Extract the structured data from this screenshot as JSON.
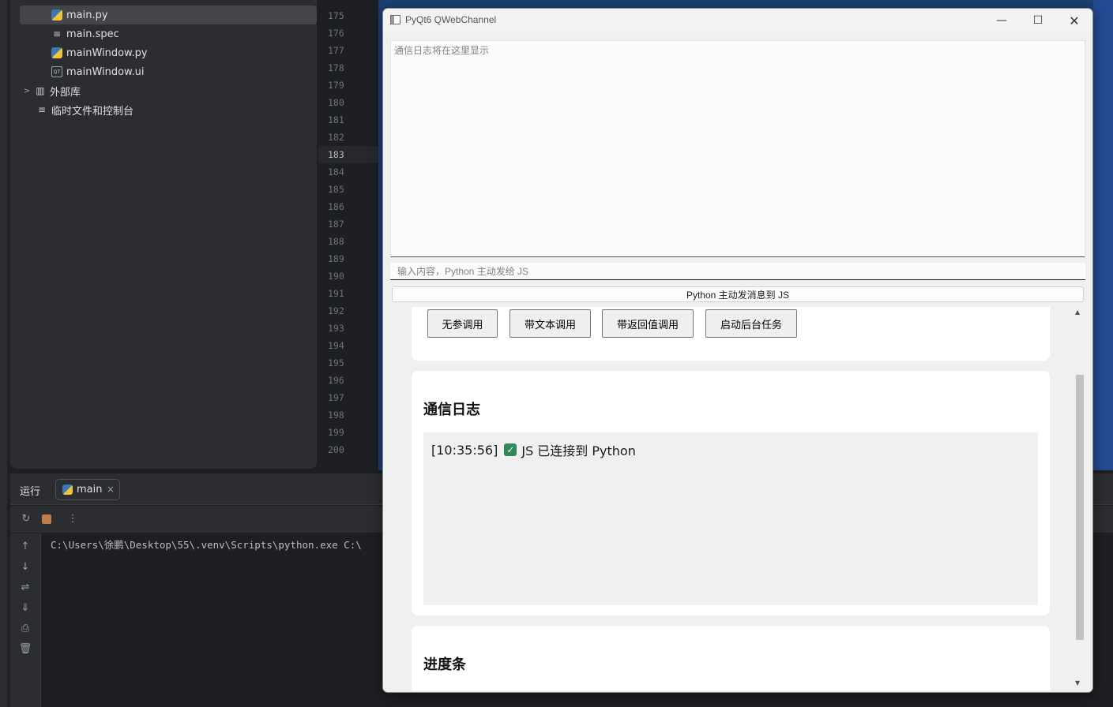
{
  "project_tree": {
    "items": [
      {
        "label": "main.py",
        "icon": "python-file-icon",
        "selected": true
      },
      {
        "label": "main.spec",
        "icon": "spec-file-icon"
      },
      {
        "label": "mainWindow.py",
        "icon": "python-file-icon"
      },
      {
        "label": "mainWindow.ui",
        "icon": "ui-file-icon"
      },
      {
        "label": "外部库",
        "icon": "library-icon"
      },
      {
        "label": "临时文件和控制台",
        "icon": "scratches-icon"
      }
    ]
  },
  "editor": {
    "line_numbers": [
      "175",
      "176",
      "177",
      "178",
      "179",
      "180",
      "181",
      "182",
      "183",
      "184",
      "185",
      "186",
      "187",
      "188",
      "189",
      "190",
      "191",
      "192",
      "193",
      "194",
      "195",
      "196",
      "197",
      "198",
      "199",
      "200"
    ],
    "current_line": "183"
  },
  "run_panel": {
    "title": "运行",
    "tab_label": "main",
    "console_line": "C:\\Users\\徐鹏\\Desktop\\55\\.venv\\Scripts\\python.exe C:\\"
  },
  "qt_window": {
    "title": "PyQt6 QWebChannel",
    "log_placeholder": "通信日志将在这里显示",
    "input_placeholder": "输入内容，Python 主动发给 JS",
    "send_button": "Python 主动发消息到 JS",
    "web": {
      "buttons": [
        "无参调用",
        "带文本调用",
        "带返回值调用",
        "启动后台任务"
      ],
      "log_title": "通信日志",
      "log_entry": {
        "time": "[10:35:56]",
        "text": "JS 已连接到 Python"
      },
      "progress_title": "进度条"
    }
  },
  "colors": {
    "ide_bg": "#1e1f22",
    "ide_panel": "#2b2d30",
    "check_green": "#2e8b57",
    "qt_bg": "#f0f0f0"
  }
}
